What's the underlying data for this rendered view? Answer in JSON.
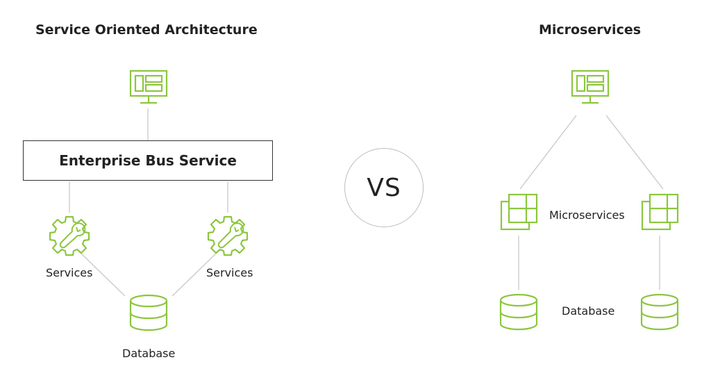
{
  "colors": {
    "icon_green": "#8cc63f",
    "connector_gray": "#c8c8c8",
    "text": "#222222",
    "box_border": "#333333"
  },
  "soa": {
    "title": "Service Oriented Architecture",
    "client_icon": "monitor-icon",
    "bus_label": "Enterprise Bus Service",
    "services": [
      {
        "label": "Services",
        "icon": "gear-wrench-icon"
      },
      {
        "label": "Services",
        "icon": "gear-wrench-icon"
      }
    ],
    "database": {
      "label": "Database",
      "icon": "database-icon"
    }
  },
  "vs_label": "VS",
  "microservices": {
    "title": "Microservices",
    "client_icon": "monitor-icon",
    "services_label": "Microservices",
    "service_icon": "microservice-grid-icon",
    "database_label": "Database",
    "database_icon": "database-icon"
  }
}
